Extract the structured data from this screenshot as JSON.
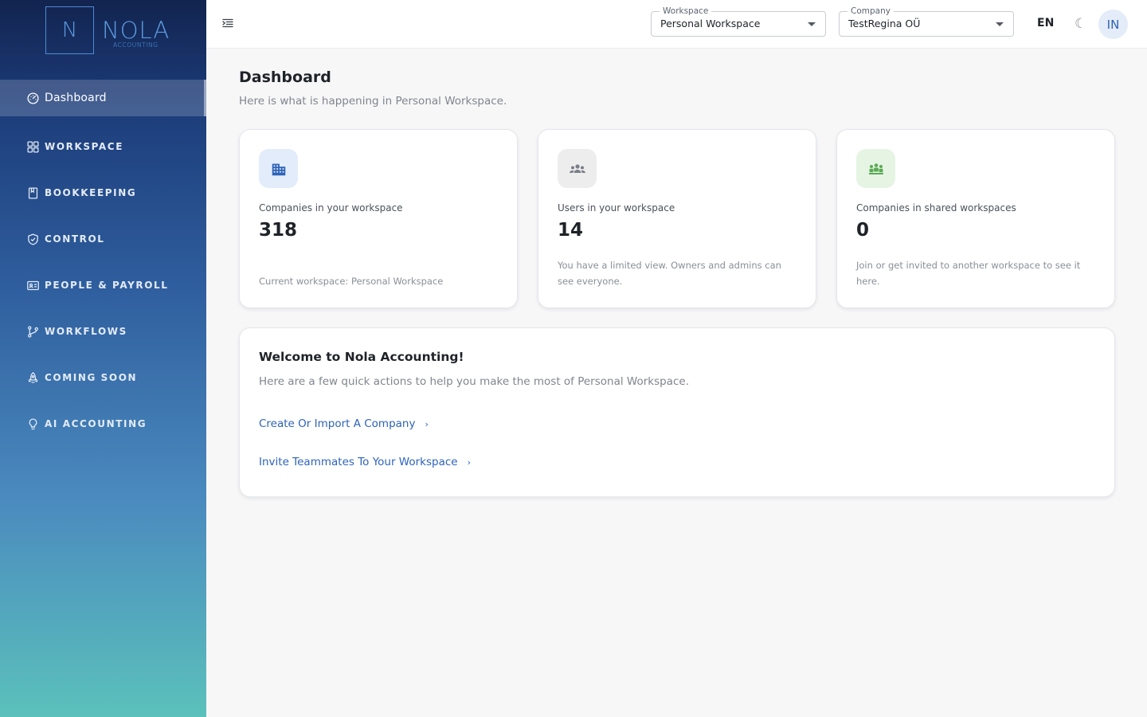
{
  "brand": {
    "logo_letter": "N",
    "name": "NOLA",
    "subtitle": "ACCOUNTING"
  },
  "sidebar": {
    "items": [
      {
        "label": "Dashboard",
        "icon": "gauge-icon",
        "active": true
      },
      {
        "label": "WORKSPACE",
        "icon": "grid-icon"
      },
      {
        "label": "BOOKKEEPING",
        "icon": "book-icon"
      },
      {
        "label": "CONTROL",
        "icon": "shield-check-icon"
      },
      {
        "label": "PEOPLE & PAYROLL",
        "icon": "id-card-icon"
      },
      {
        "label": "WORKFLOWS",
        "icon": "branch-icon"
      },
      {
        "label": "COMING SOON",
        "icon": "rocket-icon"
      },
      {
        "label": "AI ACCOUNTING",
        "icon": "lightbulb-icon"
      }
    ]
  },
  "topbar": {
    "workspace": {
      "legend": "Workspace",
      "value": "Personal Workspace"
    },
    "company": {
      "legend": "Company",
      "value": "TestRegina OÜ"
    },
    "language": "EN",
    "theme_icon": "moon-icon",
    "avatar_initials": "IN"
  },
  "page": {
    "title": "Dashboard",
    "subtitle": "Here is what is happening in Personal Workspace."
  },
  "cards": [
    {
      "label": "Companies in your workspace",
      "value": "318",
      "note": "Current workspace: Personal Workspace",
      "icon": "building-icon",
      "icon_bg": "#e3ecfb",
      "icon_color": "#2e63b8"
    },
    {
      "label": "Users in your workspace",
      "value": "14",
      "note": "You have a limited view. Owners and admins can see everyone.",
      "icon": "users-icon",
      "icon_bg": "#ededee",
      "icon_color": "#7a7f87"
    },
    {
      "label": "Companies in shared workspaces",
      "value": "0",
      "note": "Join or get invited to another workspace to see it here.",
      "icon": "groups-icon",
      "icon_bg": "#e6f4e4",
      "icon_color": "#5caa55"
    }
  ],
  "welcome": {
    "title": "Welcome to Nola Accounting!",
    "subtitle": "Here are a few quick actions to help you make the most of Personal Workspace.",
    "actions": [
      {
        "label": "Create Or Import A Company",
        "chevron": "›"
      },
      {
        "label": "Invite Teammates To Your Workspace",
        "chevron": "›"
      }
    ]
  },
  "colors": {
    "accent": "#2e63b8",
    "sidebar_top": "#12244f",
    "sidebar_bottom": "#5bc1bb"
  }
}
